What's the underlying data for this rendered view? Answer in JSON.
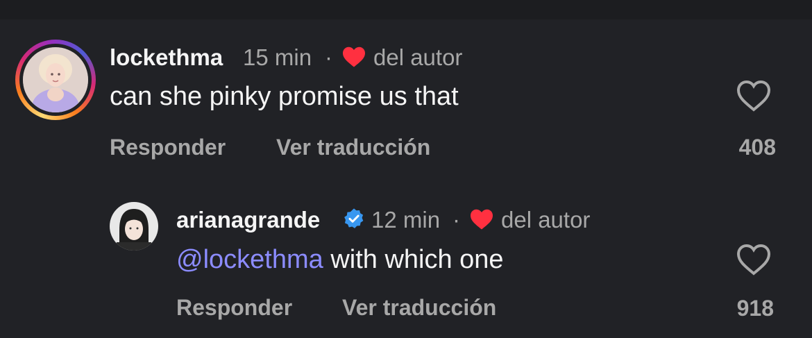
{
  "comments": [
    {
      "username": "lockethma",
      "time": "15 min",
      "separator": "·",
      "author_like_label": "del autor",
      "text": "can she pinky promise us that",
      "reply_label": "Responder",
      "translate_label": "Ver traducción",
      "like_count": "408",
      "avatar_icon": "avatar-with-story-ring",
      "like_icon": "heart-outline-icon"
    },
    {
      "username": "arianagrande",
      "verified": true,
      "time": "12 min",
      "separator": "·",
      "author_like_label": "del autor",
      "mention": "@lockethma",
      "text": " with which one",
      "reply_label": "Responder",
      "translate_label": "Ver traducción",
      "like_count": "918",
      "avatar_icon": "avatar",
      "like_icon": "heart-outline-icon"
    }
  ],
  "colors": {
    "background": "#212226",
    "primary_text": "#f5f5f5",
    "secondary_text": "#a8a8a8",
    "mention": "#8c8cff",
    "author_heart": "#ff3040",
    "verified": "#3897f0"
  }
}
